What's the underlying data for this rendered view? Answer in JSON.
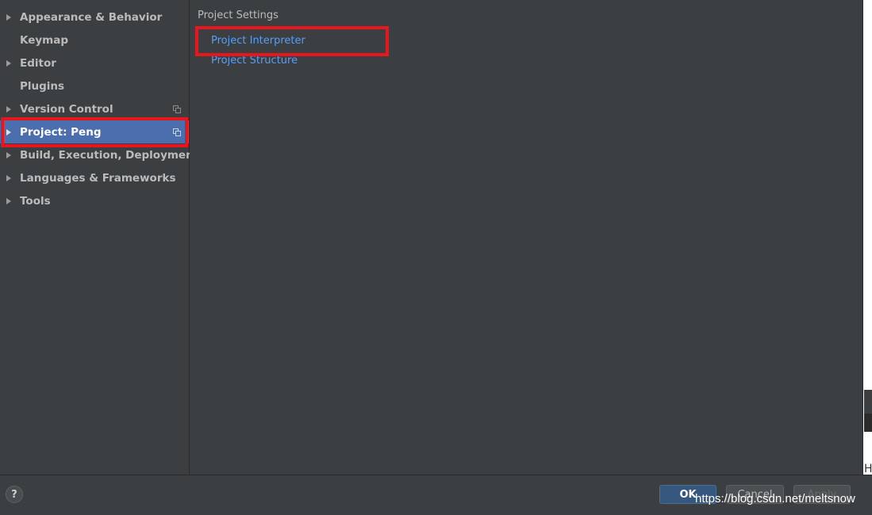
{
  "sidebar": {
    "items": [
      {
        "label": "Appearance & Behavior",
        "has_arrow": true
      },
      {
        "label": "Keymap",
        "has_arrow": false
      },
      {
        "label": "Editor",
        "has_arrow": true
      },
      {
        "label": "Plugins",
        "has_arrow": false
      },
      {
        "label": "Version Control",
        "has_arrow": true,
        "has_copy_icon": true
      },
      {
        "label": "Project: Peng",
        "has_arrow": true,
        "has_copy_icon": true,
        "selected": true
      },
      {
        "label": "Build, Execution, Deployment",
        "has_arrow": true
      },
      {
        "label": "Languages & Frameworks",
        "has_arrow": true
      },
      {
        "label": "Tools",
        "has_arrow": true
      }
    ]
  },
  "content": {
    "section_title": "Project Settings",
    "links": [
      {
        "label": "Project Interpreter",
        "highlighted": true
      },
      {
        "label": "Project Structure"
      }
    ]
  },
  "right_strip": {
    "fragment": "H"
  },
  "footer": {
    "help_label": "?",
    "ok_label": "OK",
    "cancel_label": "Cancel",
    "apply_label": "Apply",
    "watermark": "https://blog.csdn.net/meltsnow"
  },
  "colors": {
    "background": "#3c3f41",
    "selection": "#4b6eaf",
    "link": "#589df6",
    "annotation_red": "#e8161c",
    "ok_button": "#365880"
  },
  "icons": {
    "expand": "triangle-right-icon",
    "project_scope": "copy-icon",
    "help": "help-icon"
  }
}
